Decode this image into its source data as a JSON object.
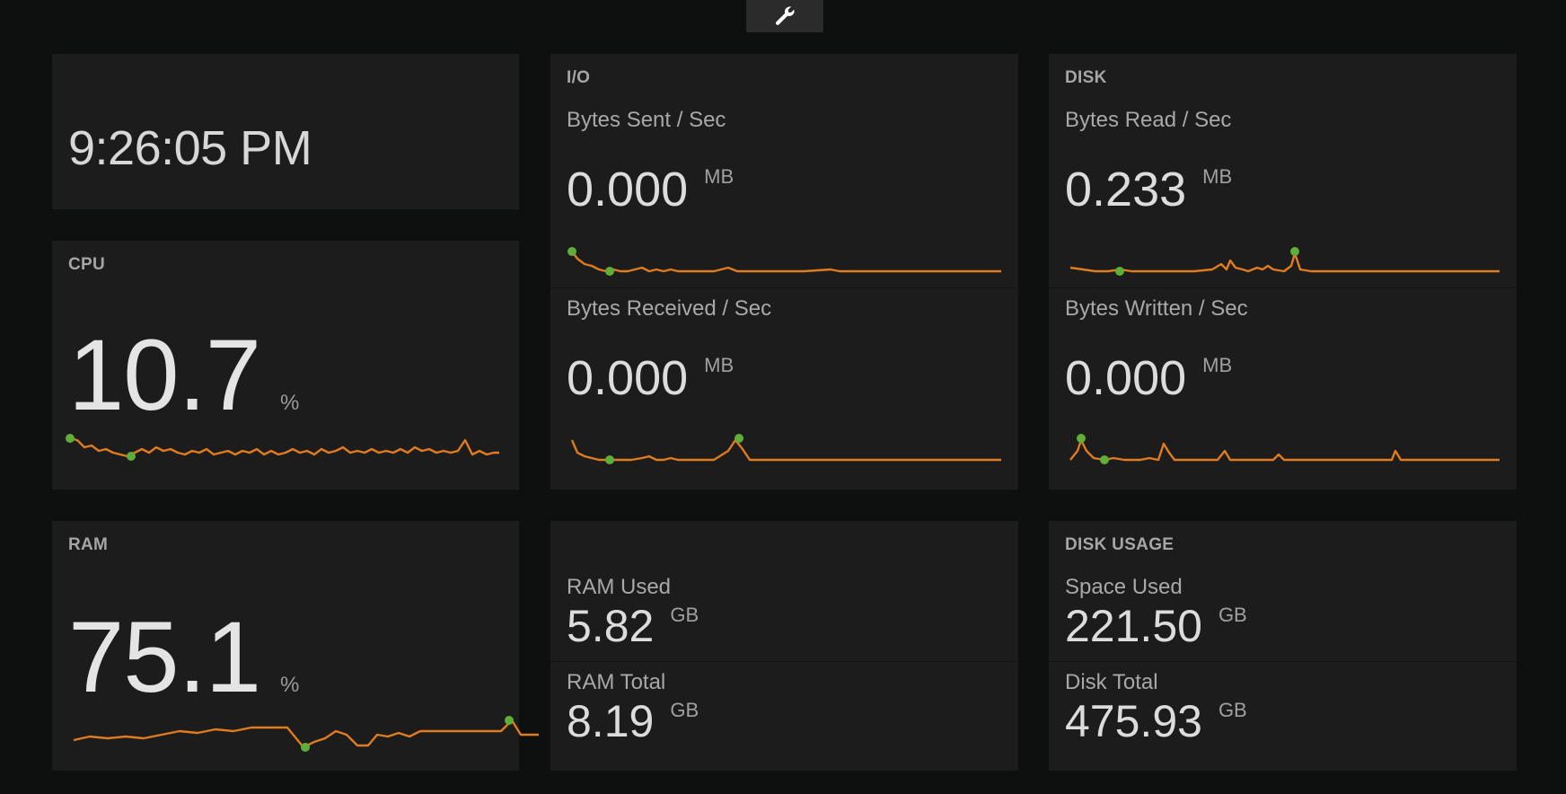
{
  "clock": {
    "time": "9:26:05 PM"
  },
  "cpu": {
    "title": "CPU",
    "value": "10.7",
    "unit": "%"
  },
  "ram": {
    "title": "RAM",
    "value": "75.1",
    "unit": "%"
  },
  "io": {
    "title": "I/O",
    "sent_label": "Bytes Sent / Sec",
    "sent_value": "0.000",
    "sent_unit": "MB",
    "recv_label": "Bytes Received / Sec",
    "recv_value": "0.000",
    "recv_unit": "MB"
  },
  "disk": {
    "title": "DISK",
    "read_label": "Bytes Read / Sec",
    "read_value": "0.233",
    "read_unit": "MB",
    "write_label": "Bytes Written / Sec",
    "write_value": "0.000",
    "write_unit": "MB"
  },
  "memory": {
    "used_label": "RAM Used",
    "used_value": "5.82",
    "used_unit": "GB",
    "total_label": "RAM Total",
    "total_value": "8.19",
    "total_unit": "GB"
  },
  "disk_usage": {
    "title": "DISK USAGE",
    "used_label": "Space Used",
    "used_value": "221.50",
    "used_unit": "GB",
    "total_label": "Disk Total",
    "total_value": "475.93",
    "total_unit": "GB"
  },
  "icons": {
    "settings": "wrench-icon"
  },
  "colors": {
    "background": "#0e1010",
    "panel": "#1c1c1c",
    "line": "#e07b1f",
    "marker": "#5fae3a"
  }
}
